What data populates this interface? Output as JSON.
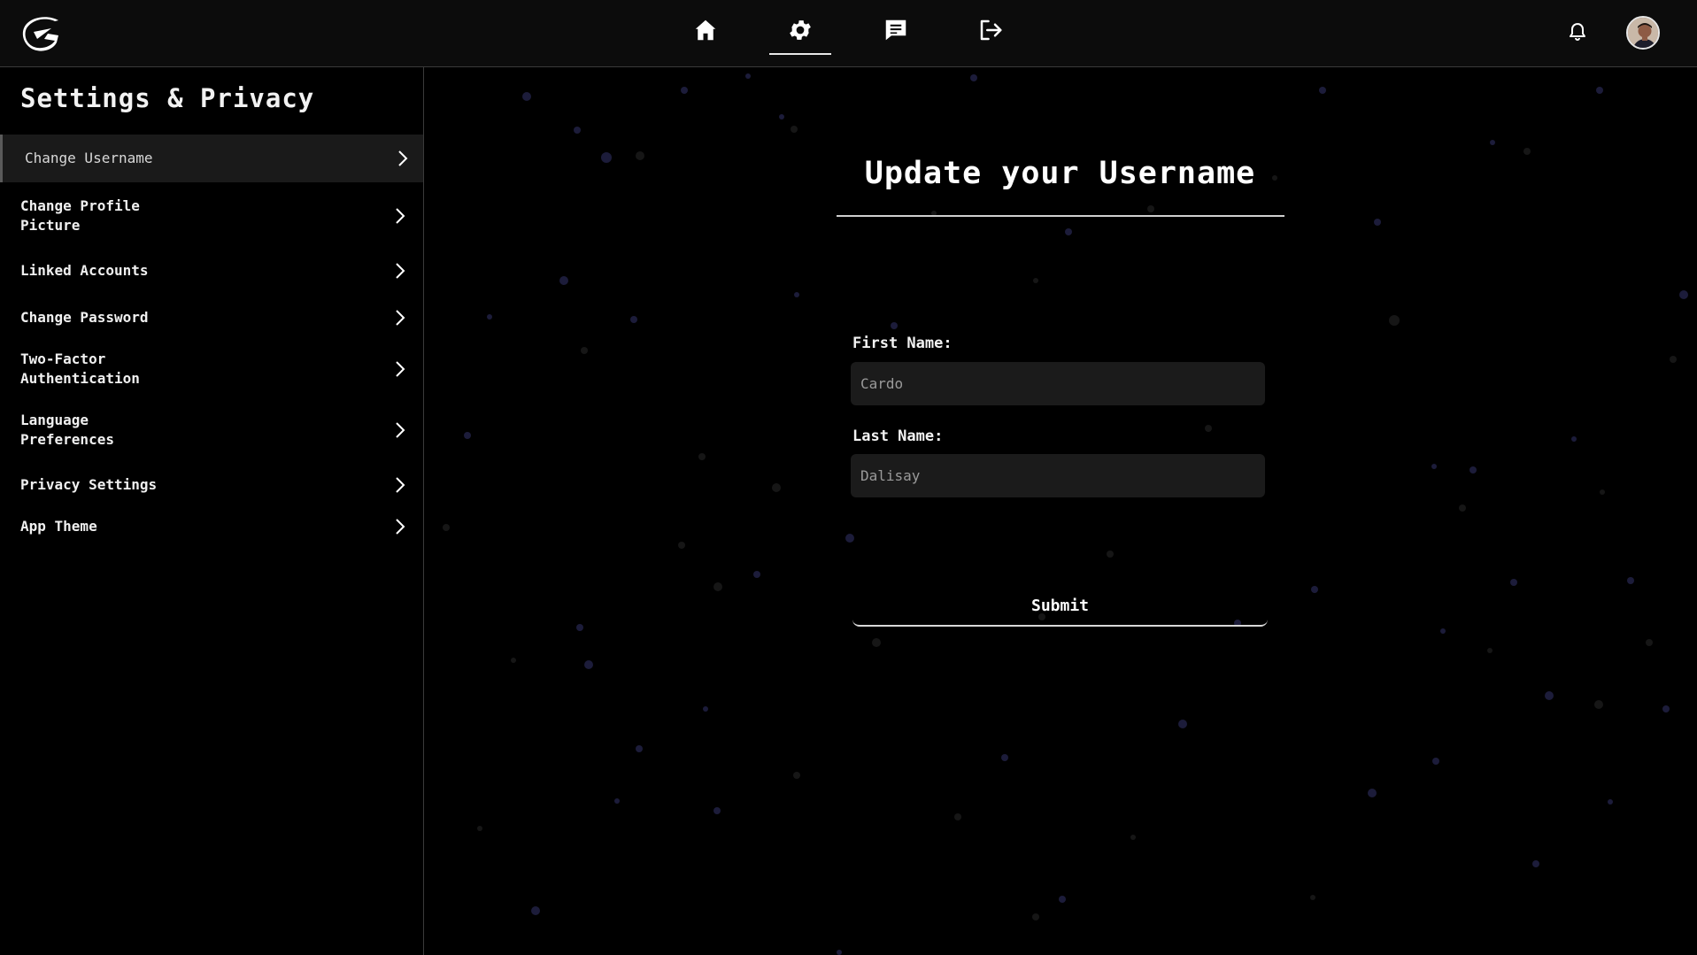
{
  "topbar": {
    "logo_icon": "cyber-g-logo-icon",
    "nav": [
      {
        "icon": "home-icon",
        "active": false
      },
      {
        "icon": "gear-icon",
        "active": true
      },
      {
        "icon": "chat-icon",
        "active": false
      },
      {
        "icon": "logout-icon",
        "active": false
      }
    ],
    "notifications_icon": "bell-icon",
    "avatar": "user-avatar"
  },
  "sidebar": {
    "title": "Settings & Privacy",
    "items": [
      {
        "label": "Change Username",
        "active": true
      },
      {
        "label": "Change Profile Picture",
        "active": false
      },
      {
        "label": "Linked Accounts",
        "active": false
      },
      {
        "label": "Change Password",
        "active": false
      },
      {
        "label": "Two-Factor Authentication",
        "active": false
      },
      {
        "label": "Language Preferences",
        "active": false
      },
      {
        "label": "Privacy Settings",
        "active": false
      },
      {
        "label": "App Theme",
        "active": false
      }
    ]
  },
  "form": {
    "heading": "Update your Username",
    "first_name_label": "First Name:",
    "first_name_placeholder": "Cardo",
    "last_name_label": "Last Name:",
    "last_name_placeholder": "Dalisay",
    "submit_label": "Submit"
  },
  "colors": {
    "background": "#000000",
    "topbar": "#0c0c0c",
    "input_bg": "#1b1b1b",
    "active_item_bg": "#1a1a1a",
    "text": "#ffffff"
  }
}
